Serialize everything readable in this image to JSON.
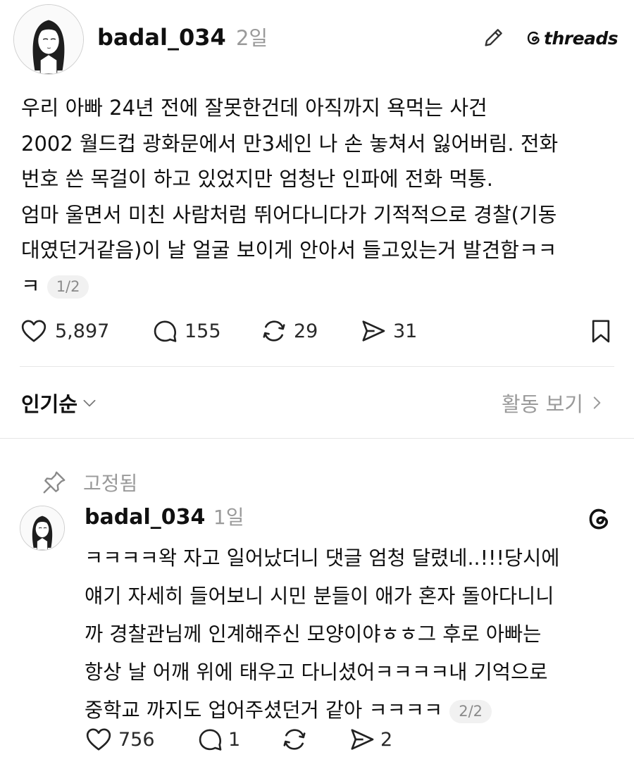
{
  "post": {
    "username": "badal_034",
    "time": "2일",
    "brand": "threads",
    "lines": [
      "우리 아빠 24년 전에 잘못한건데 아직까지 욕먹는 사건",
      "2002 월드컵 광화문에서 만3세인 나 손 놓쳐서 잃어버림. 전화",
      "번호 쓴 목걸이 하고 있었지만 엄청난 인파에 전화 먹통.",
      "엄마 울면서 미친 사람처럼 뛰어다니다가 기적적으로 경찰(기동",
      "대였던거같음)이 날 얼굴 보이게 안아서 들고있는거 발견함ㅋㅋ",
      "ㅋ"
    ],
    "page_indicator": "1/2",
    "likes": "5,897",
    "comments": "155",
    "reposts": "29",
    "shares": "31"
  },
  "sort": {
    "label": "인기순",
    "activity_label": "활동 보기"
  },
  "reply": {
    "pinned_label": "고정됨",
    "username": "badal_034",
    "time": "1일",
    "lines": [
      "ㅋㅋㅋㅋ왁 자고 일어났더니 댓글 엄청 달렸네..!!!당시에",
      "얘기 자세히 들어보니 시민 분들이 애가 혼자 돌아다니니",
      "까 경찰관님께 인계해주신 모양이야ㅎㅎ그 후로 아빠는",
      "항상 날 어깨 위에 태우고 다니셨어ㅋㅋㅋㅋ내 기억으로",
      "중학교 까지도 업어주셨던거 같아 ㅋㅋㅋㅋ"
    ],
    "page_indicator": "2/2",
    "likes": "756",
    "comments": "1",
    "shares": "2"
  }
}
